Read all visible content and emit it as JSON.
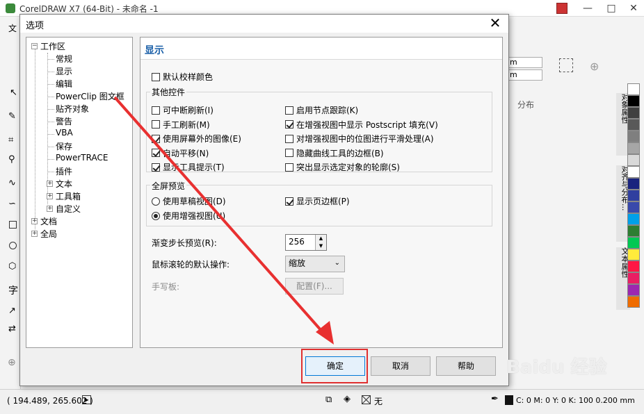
{
  "app": {
    "title": "CorelDRAW X7 (64-Bit) - 未命名 -1",
    "menu_first": "文",
    "text_tool": "字",
    "docker_label": "分布",
    "docker_tabs": [
      "对象属性",
      "对齐与分布...",
      "文本属性"
    ],
    "unit_a": "m",
    "unit_b": "m",
    "status": {
      "coords": "( 194.489, 265.602 )",
      "fill": "无",
      "outline": "C: 0 M: 0 Y: 0 K: 100  0.200 mm"
    },
    "palette": [
      "#ffffff",
      "#000000",
      "#404040",
      "#595959",
      "#7f7f7f",
      "#a6a6a6",
      "#d9d9d9",
      "#ffffff",
      "#1a237e",
      "#303f9f",
      "#3949ab",
      "#00a0e9",
      "#2e7d32",
      "#00c853",
      "#ffeb3b",
      "#ff1744",
      "#e91e63",
      "#9c27b0",
      "#ef6c00"
    ]
  },
  "dialog": {
    "title": "选项",
    "tree": [
      {
        "label": "工作区",
        "level": 0,
        "expander": "-"
      },
      {
        "label": "常规",
        "level": 1
      },
      {
        "label": "显示",
        "level": 1
      },
      {
        "label": "编辑",
        "level": 1
      },
      {
        "label": "PowerClip 图文框",
        "level": 1
      },
      {
        "label": "贴齐对象",
        "level": 1
      },
      {
        "label": "警告",
        "level": 1
      },
      {
        "label": "VBA",
        "level": 1
      },
      {
        "label": "保存",
        "level": 1
      },
      {
        "label": "PowerTRACE",
        "level": 1
      },
      {
        "label": "插件",
        "level": 1
      },
      {
        "label": "文本",
        "level": 1,
        "expander": "+"
      },
      {
        "label": "工具箱",
        "level": 1,
        "expander": "+"
      },
      {
        "label": "自定义",
        "level": 1,
        "expander": "+"
      },
      {
        "label": "文档",
        "level": 0,
        "expander": "+"
      },
      {
        "label": "全局",
        "level": 0,
        "expander": "+"
      }
    ],
    "section_title": "显示",
    "default_proof_color": {
      "label": "默认校样颜色",
      "checked": false
    },
    "other_controls_label": "其他控件",
    "left_options": [
      {
        "label": "可中断刷新(I)",
        "checked": false
      },
      {
        "label": "手工刷新(M)",
        "checked": false
      },
      {
        "label": "使用屏幕外的图像(E)",
        "checked": true
      },
      {
        "label": "自动平移(N)",
        "checked": true
      },
      {
        "label": "显示工具提示(T)",
        "checked": true
      }
    ],
    "right_options": [
      {
        "label": "启用节点跟踪(K)",
        "checked": false
      },
      {
        "label": "在增强视图中显示 Postscript 填充(V)",
        "checked": true
      },
      {
        "label": "对增强视图中的位图进行平滑处理(A)",
        "checked": false
      },
      {
        "label": "隐藏曲线工具的边框(B)",
        "checked": false
      },
      {
        "label": "突出显示选定对象的轮廓(S)",
        "checked": false
      }
    ],
    "fullscreen_label": "全屏预览",
    "radio_draft": {
      "label": "使用草稿视图(D)",
      "selected": false
    },
    "radio_enhanced": {
      "label": "使用增强视图(U)",
      "selected": true
    },
    "show_page_border": {
      "label": "显示页边框(P)",
      "checked": true
    },
    "gradient_steps_label": "渐变步长预览(R):",
    "gradient_steps_value": "256",
    "wheel_label": "鼠标滚轮的默认操作:",
    "wheel_value": "缩放",
    "pen_label": "手写板:",
    "configure_button": "配置(F)...",
    "ok_button": "确定",
    "cancel_button": "取消",
    "help_button": "帮助"
  },
  "watermark": "Baidu 经验"
}
